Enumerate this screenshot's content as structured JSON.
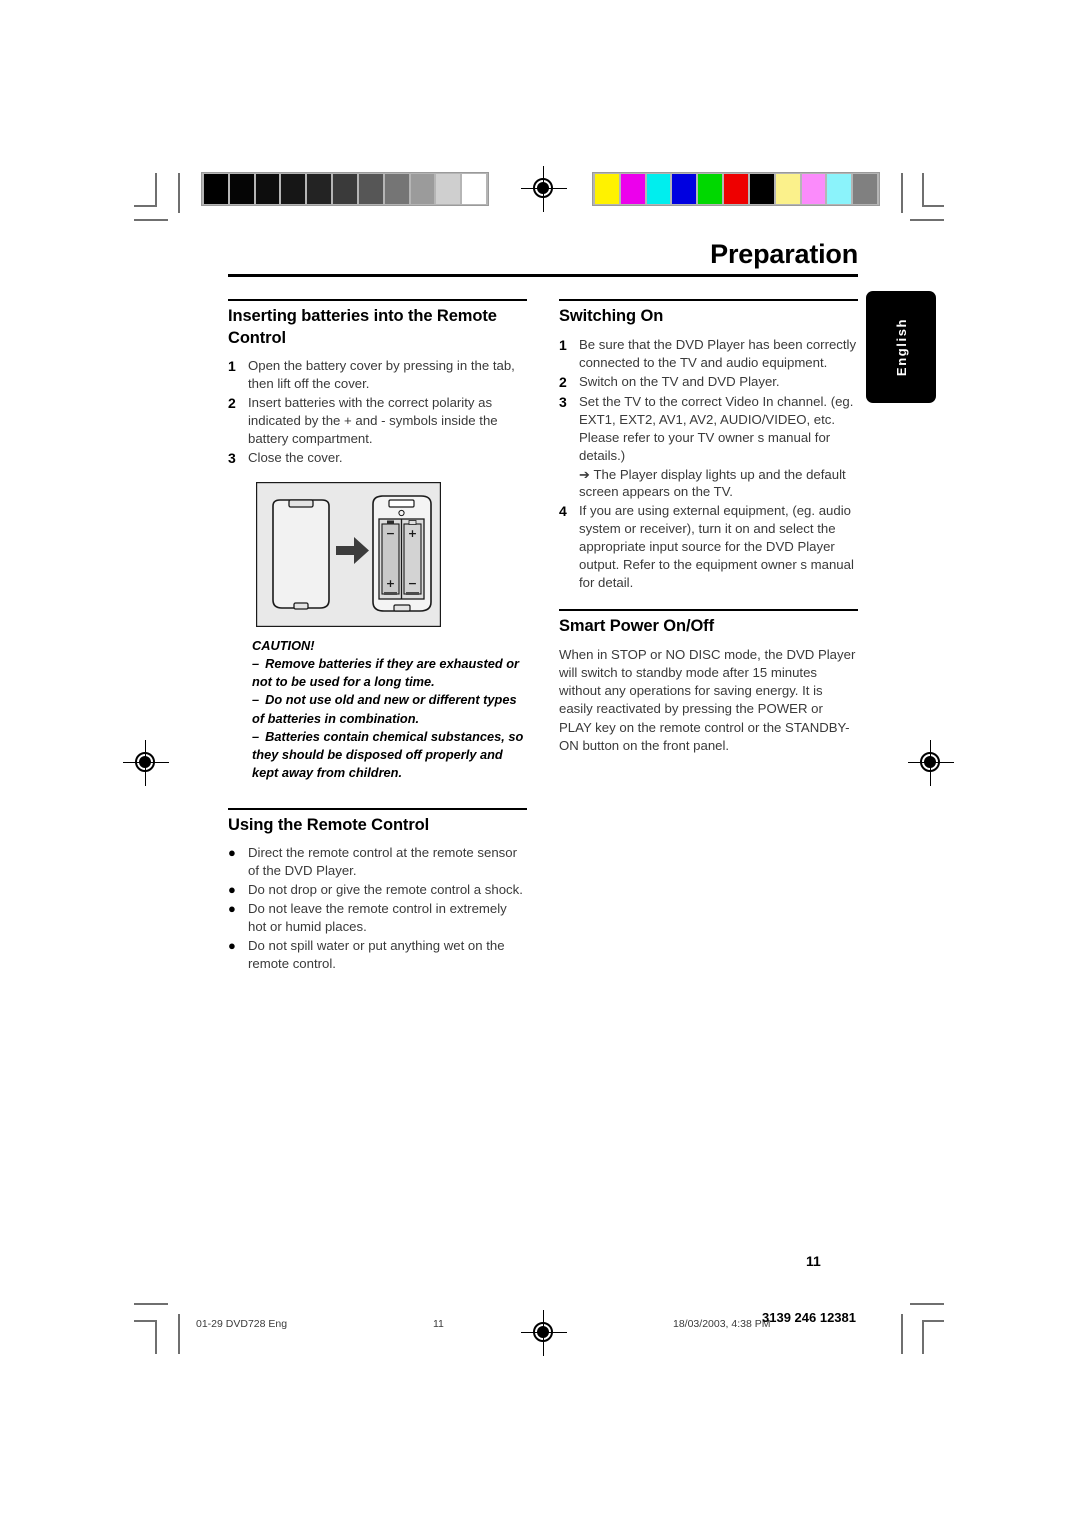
{
  "document": {
    "title": "Preparation",
    "page_number": "11",
    "language_tab": "English"
  },
  "left_column": {
    "section1": {
      "heading": "Inserting batteries into the Remote Control",
      "steps": [
        {
          "num": "1",
          "text": "Open the battery cover by pressing in the tab, then lift off the cover."
        },
        {
          "num": "2",
          "text": "Insert batteries with the correct polarity as indicated by the + and - symbols inside the battery compartment."
        },
        {
          "num": "3",
          "text": "Close the cover."
        }
      ]
    },
    "figure": {
      "name": "remote-control-battery-diagram",
      "battery_labels": [
        "–",
        "+",
        "+",
        "–"
      ]
    },
    "caution": {
      "heading": "CAUTION!",
      "items": [
        "Remove batteries if they are exhausted or not to be used for a long time.",
        "Do not use old and new or different types of batteries in combination.",
        "Batteries contain chemical substances, so they should be disposed off properly and kept away from children."
      ],
      "dash": "–"
    },
    "section2": {
      "heading": "Using the Remote Control",
      "bullet": "●",
      "items": [
        "Direct the remote control at the remote sensor of the DVD Player.",
        "Do not drop or give the remote control a shock.",
        "Do not leave the remote control in extremely hot or humid places.",
        "Do not spill water or put anything wet on the remote control."
      ]
    }
  },
  "right_column": {
    "section1": {
      "heading": "Switching On",
      "steps": [
        {
          "num": "1",
          "text": "Be sure that the DVD Player has been correctly connected to the TV and audio equipment."
        },
        {
          "num": "2",
          "text": "Switch on the TV and DVD Player."
        },
        {
          "num": "3",
          "text": "Set the TV to the correct Video In channel. (eg. EXT1, EXT2, AV1, AV2, AUDIO/VIDEO, etc. Please refer to your TV owner s manual for details.)",
          "sub": "➔ The Player display lights up and the default screen appears on the TV."
        },
        {
          "num": "4",
          "text": "If you are using external equipment, (eg. audio system or receiver), turn it on and select the appropriate input source for the DVD Player output. Refer to the equipment owner s manual for detail."
        }
      ]
    },
    "section2": {
      "heading": "Smart Power On/Off",
      "paragraph": "When in STOP or NO DISC mode, the DVD Player will switch to standby mode after 15 minutes without any operations for saving energy. It is easily reactivated by pressing the POWER or PLAY key on the remote control or the STANDBY-ON button on the front panel."
    }
  },
  "footer": {
    "file_name": "01-29 DVD728 Eng",
    "page": "11",
    "timestamp": "18/03/2003, 4:38 PM",
    "code": "3139 246 12381"
  },
  "print_marks": {
    "grayscale_ramp": [
      "#000000",
      "#050505",
      "#0d0d0d",
      "#161616",
      "#232323",
      "#3a3a3a",
      "#565656",
      "#757575",
      "#9b9b9b",
      "#cfcfcf",
      "#ffffff"
    ],
    "color_bar": [
      "#fff200",
      "#ec00ec",
      "#00eeee",
      "#0000e0",
      "#00d800",
      "#ee0000",
      "#000000",
      "#fbf18b",
      "#fb8bfb",
      "#8bf3fb",
      "#808080"
    ]
  }
}
